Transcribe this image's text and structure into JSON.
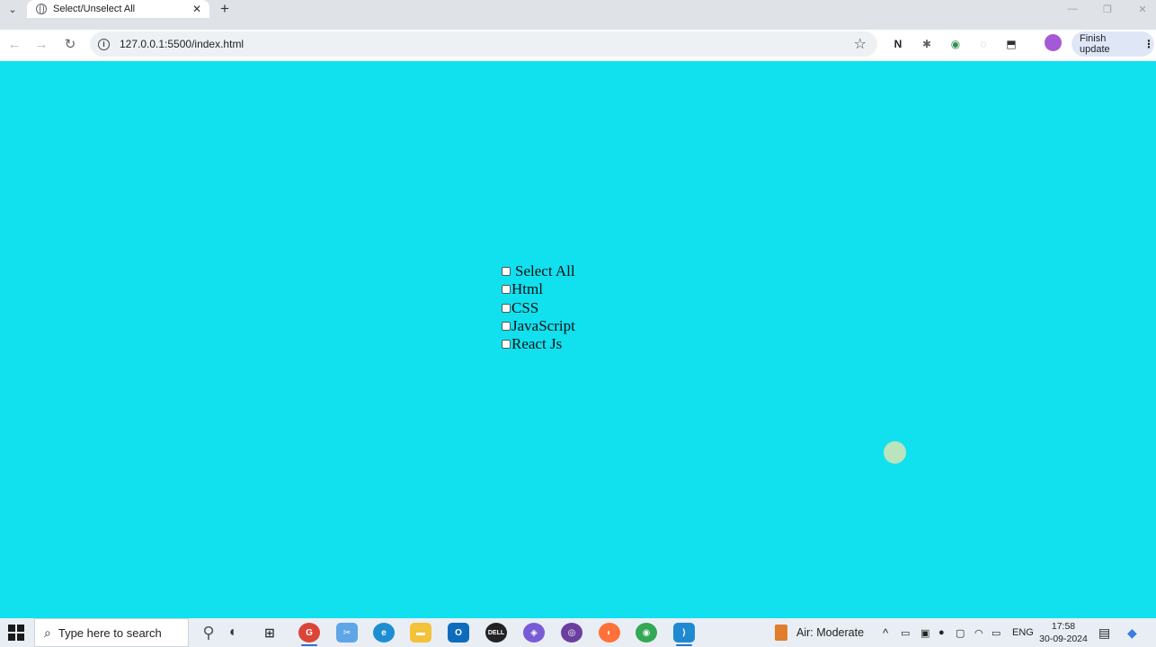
{
  "browser": {
    "tab": {
      "title": "Select/Unselect All",
      "close": "✕"
    },
    "new_tab": "+",
    "window_controls": {
      "minimize": "—",
      "restore": "❐",
      "close": "✕"
    },
    "nav": {
      "back": "←",
      "forward": "→",
      "reload": "↻"
    },
    "address": {
      "info_glyph": "i",
      "url": "127.0.0.1:5500/index.html",
      "bookmark_glyph": "☆"
    },
    "extensions": [
      "N",
      "✱",
      "◉",
      "◌",
      "⬒"
    ],
    "finish_update": {
      "label": "Finish update",
      "menu_glyph": "⋮"
    }
  },
  "page": {
    "background": "#11e0ef",
    "checkboxes": [
      {
        "label": "Select All",
        "checked": false
      },
      {
        "label": "Html",
        "checked": false
      },
      {
        "label": "CSS",
        "checked": false
      },
      {
        "label": "JavaScript",
        "checked": false
      },
      {
        "label": "React Js",
        "checked": false
      }
    ]
  },
  "taskbar": {
    "search_placeholder": "Type here to search",
    "search_glyph": "⌕",
    "apps": [
      "google-chrome-work",
      "snipping-tool",
      "edge",
      "file-explorer",
      "outlook",
      "dell",
      "copilot",
      "github-desktop",
      "firefox",
      "chrome",
      "vs-code"
    ],
    "weather": "Air: Moderate",
    "tray_language": "ENG",
    "time": "17:58",
    "date": "30-09-2024"
  },
  "colors": {
    "accent": "#2e6fd3",
    "page_bg": "#11e0ef",
    "update_pill": "#dfe7f7"
  }
}
